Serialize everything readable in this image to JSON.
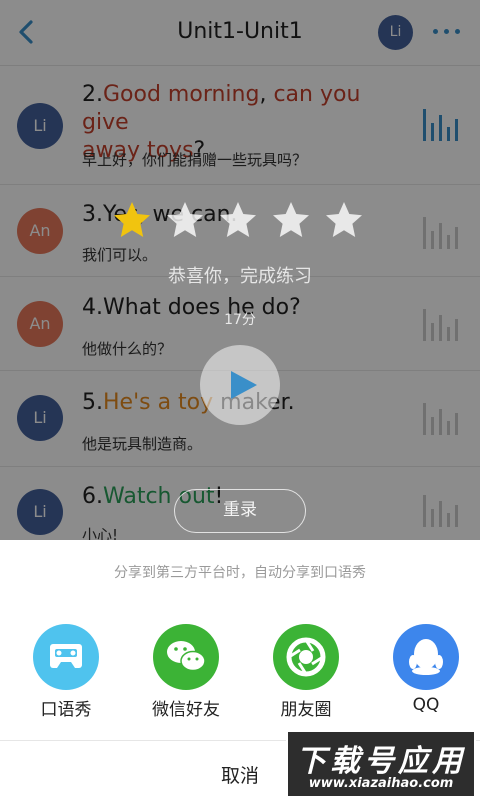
{
  "header": {
    "title": "Unit1-Unit1",
    "avatar_initials": "Li"
  },
  "rows": [
    {
      "avatar": "Li",
      "en_prefix": "2.",
      "en_seg1": "Good morning",
      "en_seg2": ", ",
      "en_seg3": "can you give",
      "en_seg4": "away toys",
      "en_seg5": "?",
      "cn": "早上好，你们能捐赠一些玩具吗？"
    },
    {
      "avatar": "An",
      "en_prefix": "3.",
      "en_text": "Yes, we can.",
      "cn": "我们可以。"
    },
    {
      "avatar": "An",
      "en_prefix": "4.",
      "en_text": "What does he do?",
      "cn": "他做什么的？"
    },
    {
      "avatar": "Li",
      "en_prefix": "5.",
      "en_hl": "He's a toy",
      "en_rest": " maker.",
      "cn": "他是玩具制造商。"
    },
    {
      "avatar": "Li",
      "en_prefix": "6.",
      "en_hl": "Watch out",
      "en_rest": "!",
      "cn": "小心!"
    }
  ],
  "result": {
    "rating": 1,
    "max_rating": 5,
    "congrats": "恭喜你，完成练习",
    "score": "17分",
    "rerecord_label": "重录"
  },
  "share": {
    "hint": "分享到第三方平台时，自动分享到口语秀",
    "items": [
      {
        "label": "口语秀",
        "icon": "cassette-icon",
        "color": "#4fc3ee"
      },
      {
        "label": "微信好友",
        "icon": "wechat-icon",
        "color": "#3cb336"
      },
      {
        "label": "朋友圈",
        "icon": "moments-shutter-icon",
        "color": "#3cb336"
      },
      {
        "label": "QQ",
        "icon": "qq-penguin-icon",
        "color": "#3d86ec"
      }
    ],
    "cancel_label": "取消"
  },
  "watermark": {
    "brand": "下载号应用",
    "url": "www.xiazaihao.com"
  },
  "colors": {
    "accent": "#3a8fc9",
    "highlight_red": "#c4412c",
    "highlight_orange": "#e58a20",
    "highlight_green": "#2aa05a",
    "star_gold": "#f1c40f"
  }
}
